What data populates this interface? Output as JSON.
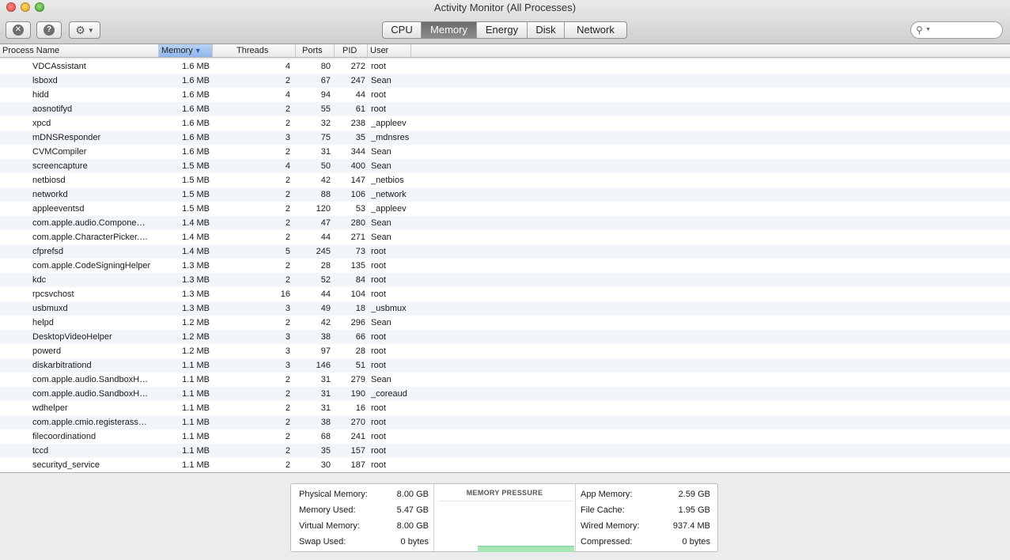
{
  "window": {
    "title": "Activity Monitor (All Processes)"
  },
  "toolbar": {
    "stop_icon": "x-circle-icon",
    "info_icon": "info-icon",
    "gear_icon": "gear-icon",
    "tabs": [
      "CPU",
      "Memory",
      "Energy",
      "Disk",
      "Network"
    ],
    "active_tab": "Memory",
    "search_placeholder": ""
  },
  "table": {
    "headers": {
      "name": "Process Name",
      "memory": "Memory",
      "threads": "Threads",
      "ports": "Ports",
      "pid": "PID",
      "user": "User"
    },
    "sort_column": "Memory",
    "rows": [
      [
        "VDCAssistant",
        "1.6 MB",
        "4",
        "80",
        "272",
        "root"
      ],
      [
        "lsboxd",
        "1.6 MB",
        "2",
        "67",
        "247",
        "Sean"
      ],
      [
        "hidd",
        "1.6 MB",
        "4",
        "94",
        "44",
        "root"
      ],
      [
        "aosnotifyd",
        "1.6 MB",
        "2",
        "55",
        "61",
        "root"
      ],
      [
        "xpcd",
        "1.6 MB",
        "2",
        "32",
        "238",
        "_appleev"
      ],
      [
        "mDNSResponder",
        "1.6 MB",
        "3",
        "75",
        "35",
        "_mdnsres"
      ],
      [
        "CVMCompiler",
        "1.6 MB",
        "2",
        "31",
        "344",
        "Sean"
      ],
      [
        "screencapture",
        "1.5 MB",
        "4",
        "50",
        "400",
        "Sean"
      ],
      [
        "netbiosd",
        "1.5 MB",
        "2",
        "42",
        "147",
        "_netbios"
      ],
      [
        "networkd",
        "1.5 MB",
        "2",
        "88",
        "106",
        "_network"
      ],
      [
        "appleeventsd",
        "1.5 MB",
        "2",
        "120",
        "53",
        "_appleev"
      ],
      [
        "com.apple.audio.Compone…",
        "1.4 MB",
        "2",
        "47",
        "280",
        "Sean"
      ],
      [
        "com.apple.CharacterPicker.…",
        "1.4 MB",
        "2",
        "44",
        "271",
        "Sean"
      ],
      [
        "cfprefsd",
        "1.4 MB",
        "5",
        "245",
        "73",
        "root"
      ],
      [
        "com.apple.CodeSigningHelper",
        "1.3 MB",
        "2",
        "28",
        "135",
        "root"
      ],
      [
        "kdc",
        "1.3 MB",
        "2",
        "52",
        "84",
        "root"
      ],
      [
        "rpcsvchost",
        "1.3 MB",
        "16",
        "44",
        "104",
        "root"
      ],
      [
        "usbmuxd",
        "1.3 MB",
        "3",
        "49",
        "18",
        "_usbmux"
      ],
      [
        "helpd",
        "1.2 MB",
        "2",
        "42",
        "296",
        "Sean"
      ],
      [
        "DesktopVideoHelper",
        "1.2 MB",
        "3",
        "38",
        "66",
        "root"
      ],
      [
        "powerd",
        "1.2 MB",
        "3",
        "97",
        "28",
        "root"
      ],
      [
        "diskarbitrationd",
        "1.1 MB",
        "3",
        "146",
        "51",
        "root"
      ],
      [
        "com.apple.audio.SandboxH…",
        "1.1 MB",
        "2",
        "31",
        "279",
        "Sean"
      ],
      [
        "com.apple.audio.SandboxH…",
        "1.1 MB",
        "2",
        "31",
        "190",
        "_coreaud"
      ],
      [
        "wdhelper",
        "1.1 MB",
        "2",
        "31",
        "16",
        "root"
      ],
      [
        "com.apple.cmio.registerass…",
        "1.1 MB",
        "2",
        "38",
        "270",
        "root"
      ],
      [
        "filecoordinationd",
        "1.1 MB",
        "2",
        "68",
        "241",
        "root"
      ],
      [
        "tccd",
        "1.1 MB",
        "2",
        "35",
        "157",
        "root"
      ],
      [
        "securityd_service",
        "1.1 MB",
        "2",
        "30",
        "187",
        "root"
      ]
    ]
  },
  "memory_stats": {
    "left": [
      {
        "label": "Physical Memory:",
        "value": "8.00 GB"
      },
      {
        "label": "Memory Used:",
        "value": "5.47 GB"
      },
      {
        "label": "Virtual Memory:",
        "value": "8.00 GB"
      },
      {
        "label": "Swap Used:",
        "value": "0 bytes"
      }
    ],
    "pressure_title": "MEMORY PRESSURE",
    "pressure_color": "#a8e6b6",
    "right": [
      {
        "label": "App Memory:",
        "value": "2.59 GB"
      },
      {
        "label": "File Cache:",
        "value": "1.95 GB"
      },
      {
        "label": "Wired Memory:",
        "value": "937.4 MB"
      },
      {
        "label": "Compressed:",
        "value": "0 bytes"
      }
    ]
  }
}
